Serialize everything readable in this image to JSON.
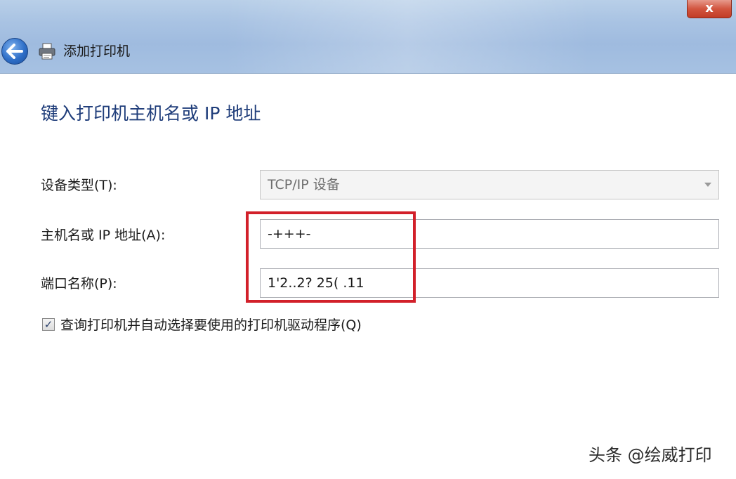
{
  "window": {
    "close_label": "x",
    "title": "添加打印机"
  },
  "page": {
    "heading": "键入打印机主机名或 IP 地址"
  },
  "form": {
    "device_type_label": "设备类型(T):",
    "device_type_value": "TCP/IP 设备",
    "hostname_label": "主机名或 IP 地址(A):",
    "hostname_value": "-+++-",
    "port_label": "端口名称(P):",
    "port_value": "1'2..2? 25( .11",
    "query_checkbox_checked": true,
    "query_checkbox_label": "查询打印机并自动选择要使用的打印机驱动程序(Q)"
  },
  "watermark": "头条 @绘威打印",
  "colors": {
    "heading": "#1f3d7a",
    "highlight": "#d2202a",
    "close_button": "#c9472f"
  }
}
